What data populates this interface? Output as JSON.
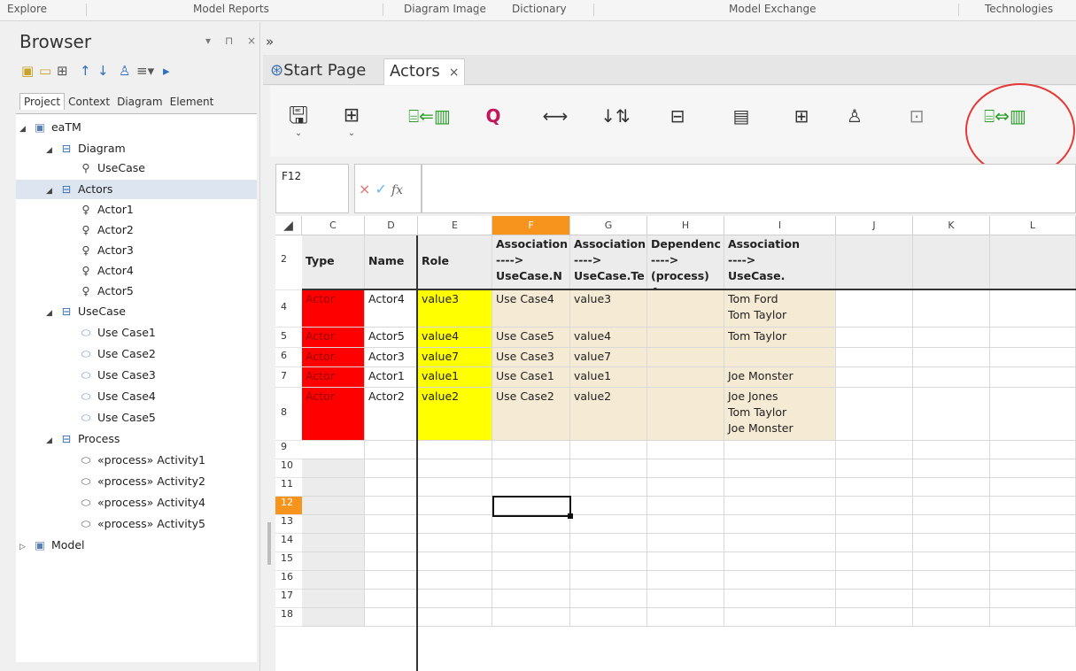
{
  "ribbon": {
    "groups": [
      "Explore",
      "Model Reports",
      "Diagram Image",
      "Dictionary",
      "Model Exchange",
      "Technologies"
    ]
  },
  "browser": {
    "title": "Browser",
    "controls": "▾ ⊓ ×",
    "tabs": [
      "Project",
      "Context",
      "Diagram",
      "Element"
    ],
    "active_tab": "Project",
    "tree": {
      "root": "eaTM",
      "diagram_pkg": "Diagram",
      "usecase_diagram": "UseCase",
      "actors_pkg": "Actors",
      "actors": [
        "Actor1",
        "Actor2",
        "Actor3",
        "Actor4",
        "Actor5"
      ],
      "usecase_pkg": "UseCase",
      "usecases": [
        "Use Case1",
        "Use Case2",
        "Use Case3",
        "Use Case4",
        "Use Case5"
      ],
      "process_pkg": "Process",
      "activities": [
        "«process» Activity1",
        "«process» Activity2",
        "«process» Activity4",
        "«process» Activity5"
      ],
      "model": "Model"
    }
  },
  "chevron": "»",
  "doc_tabs": {
    "start_page": "Start Page",
    "actors": "Actors",
    "close": "×"
  },
  "toolbar": {
    "icons": [
      "save-icon",
      "insert-table-icon",
      "import-icon",
      "search-icon",
      "width-icon",
      "sort-az-icon",
      "hierarchy-icon",
      "template-icon",
      "elements-icon",
      "actor-icon",
      "diagram-icon",
      "export-icon"
    ]
  },
  "formula": {
    "name_box": "F12",
    "fx": "fx"
  },
  "sheet": {
    "columns": [
      "C",
      "D",
      "E",
      "F",
      "G",
      "H",
      "I",
      "J",
      "K",
      "L"
    ],
    "active_column": "F",
    "header_row": {
      "row": "2",
      "type": "Type",
      "name": "Name",
      "role": "Role",
      "F": "Association\n---->\nUseCase.N",
      "G": "Association\n---->\nUseCase.Te",
      "H": "Dependenc\n---->\n(process) A",
      "I": "Association\n---->\nUseCase."
    },
    "rows": [
      {
        "num": "4",
        "type": "Actor",
        "name": "Actor4",
        "role": "value3",
        "F": "Use Case4",
        "G": "value3",
        "H": "",
        "I": "Tom Ford\nTom Taylor"
      },
      {
        "num": "5",
        "type": "Actor",
        "name": "Actor5",
        "role": "value4",
        "F": "Use Case5",
        "G": "value4",
        "H": "",
        "I": "Tom Taylor"
      },
      {
        "num": "6",
        "type": "Actor",
        "name": "Actor3",
        "role": "value7",
        "F": "Use Case3",
        "G": "value7",
        "H": "",
        "I": ""
      },
      {
        "num": "7",
        "type": "Actor",
        "name": "Actor1",
        "role": "value1",
        "F": "Use Case1",
        "G": "value1",
        "H": "",
        "I": "Joe Monster"
      },
      {
        "num": "8",
        "type": "Actor",
        "name": "Actor2",
        "role": "value2",
        "F": "Use Case2",
        "G": "value2",
        "H": "",
        "I": "Joe Jones\nTom Taylor\nJoe Monster"
      }
    ],
    "empty_rows": [
      "9",
      "10",
      "11",
      "12",
      "13",
      "14",
      "15",
      "16",
      "17",
      "18"
    ],
    "active_row": "12",
    "colors": {
      "type": "#ff0000",
      "role": "#ffff00",
      "assoc": "#f5ead4",
      "active_header": "#f7941d"
    }
  }
}
